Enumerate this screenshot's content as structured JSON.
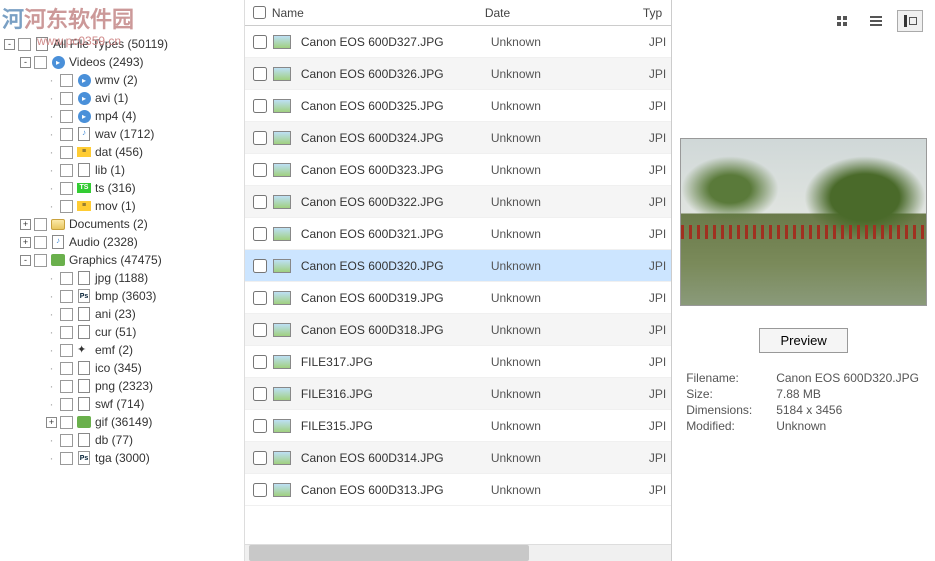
{
  "watermark": {
    "text": "河东软件园",
    "url": "www.pc0359.cn"
  },
  "tree": [
    {
      "lvl": 0,
      "toggle": "-",
      "icon": "page",
      "label": "All File Types (50119)",
      "name": "all-file-types"
    },
    {
      "lvl": 1,
      "toggle": "-",
      "icon": "video",
      "label": "Videos (2493)",
      "name": "videos"
    },
    {
      "lvl": 2,
      "toggle": "",
      "icon": "video",
      "label": "wmv (2)",
      "name": "wmv"
    },
    {
      "lvl": 2,
      "toggle": "",
      "icon": "video",
      "label": "avi (1)",
      "name": "avi"
    },
    {
      "lvl": 2,
      "toggle": "",
      "icon": "video",
      "label": "mp4 (4)",
      "name": "mp4"
    },
    {
      "lvl": 2,
      "toggle": "",
      "icon": "audio",
      "label": "wav (1712)",
      "name": "wav"
    },
    {
      "lvl": 2,
      "toggle": "",
      "icon": "dat",
      "label": "dat (456)",
      "name": "dat"
    },
    {
      "lvl": 2,
      "toggle": "",
      "icon": "page",
      "label": "lib (1)",
      "name": "lib"
    },
    {
      "lvl": 2,
      "toggle": "",
      "icon": "ts",
      "label": "ts (316)",
      "name": "ts"
    },
    {
      "lvl": 2,
      "toggle": "",
      "icon": "dat",
      "label": "mov (1)",
      "name": "mov"
    },
    {
      "lvl": 1,
      "toggle": "+",
      "icon": "folder",
      "label": "Documents (2)",
      "name": "documents"
    },
    {
      "lvl": 1,
      "toggle": "+",
      "icon": "audio",
      "label": "Audio (2328)",
      "name": "audio"
    },
    {
      "lvl": 1,
      "toggle": "-",
      "icon": "gfx",
      "label": "Graphics (47475)",
      "name": "graphics"
    },
    {
      "lvl": 2,
      "toggle": "",
      "icon": "page",
      "label": "jpg (1188)",
      "name": "jpg"
    },
    {
      "lvl": 2,
      "toggle": "",
      "icon": "ps",
      "label": "bmp (3603)",
      "name": "bmp"
    },
    {
      "lvl": 2,
      "toggle": "",
      "icon": "page",
      "label": "ani (23)",
      "name": "ani"
    },
    {
      "lvl": 2,
      "toggle": "",
      "icon": "page",
      "label": "cur (51)",
      "name": "cur"
    },
    {
      "lvl": 2,
      "toggle": "",
      "icon": "emf",
      "label": "emf (2)",
      "name": "emf"
    },
    {
      "lvl": 2,
      "toggle": "",
      "icon": "page",
      "label": "ico (345)",
      "name": "ico"
    },
    {
      "lvl": 2,
      "toggle": "",
      "icon": "page",
      "label": "png (2323)",
      "name": "png"
    },
    {
      "lvl": 2,
      "toggle": "",
      "icon": "page",
      "label": "swf (714)",
      "name": "swf"
    },
    {
      "lvl": 2,
      "toggle": "+",
      "icon": "gfx",
      "label": "gif (36149)",
      "name": "gif"
    },
    {
      "lvl": 2,
      "toggle": "",
      "icon": "page",
      "label": "db (77)",
      "name": "db"
    },
    {
      "lvl": 2,
      "toggle": "",
      "icon": "ps",
      "label": "tga (3000)",
      "name": "tga"
    }
  ],
  "columns": {
    "name": "Name",
    "date": "Date",
    "type": "Typ"
  },
  "rows": [
    {
      "name": "Canon EOS 600D327.JPG",
      "date": "Unknown",
      "type": "JPI"
    },
    {
      "name": "Canon EOS 600D326.JPG",
      "date": "Unknown",
      "type": "JPI"
    },
    {
      "name": "Canon EOS 600D325.JPG",
      "date": "Unknown",
      "type": "JPI"
    },
    {
      "name": "Canon EOS 600D324.JPG",
      "date": "Unknown",
      "type": "JPI"
    },
    {
      "name": "Canon EOS 600D323.JPG",
      "date": "Unknown",
      "type": "JPI"
    },
    {
      "name": "Canon EOS 600D322.JPG",
      "date": "Unknown",
      "type": "JPI"
    },
    {
      "name": "Canon EOS 600D321.JPG",
      "date": "Unknown",
      "type": "JPI"
    },
    {
      "name": "Canon EOS 600D320.JPG",
      "date": "Unknown",
      "type": "JPI",
      "selected": true
    },
    {
      "name": "Canon EOS 600D319.JPG",
      "date": "Unknown",
      "type": "JPI"
    },
    {
      "name": "Canon EOS 600D318.JPG",
      "date": "Unknown",
      "type": "JPI"
    },
    {
      "name": "FILE317.JPG",
      "date": "Unknown",
      "type": "JPI"
    },
    {
      "name": "FILE316.JPG",
      "date": "Unknown",
      "type": "JPI"
    },
    {
      "name": "FILE315.JPG",
      "date": "Unknown",
      "type": "JPI"
    },
    {
      "name": "Canon EOS 600D314.JPG",
      "date": "Unknown",
      "type": "JPI"
    },
    {
      "name": "Canon EOS 600D313.JPG",
      "date": "Unknown",
      "type": "JPI"
    }
  ],
  "preview": {
    "button_label": "Preview",
    "meta": {
      "filename_label": "Filename:",
      "filename": "Canon EOS 600D320.JPG",
      "size_label": "Size:",
      "size": "7.88 MB",
      "dim_label": "Dimensions:",
      "dim": "5184 x 3456",
      "mod_label": "Modified:",
      "mod": "Unknown"
    }
  }
}
